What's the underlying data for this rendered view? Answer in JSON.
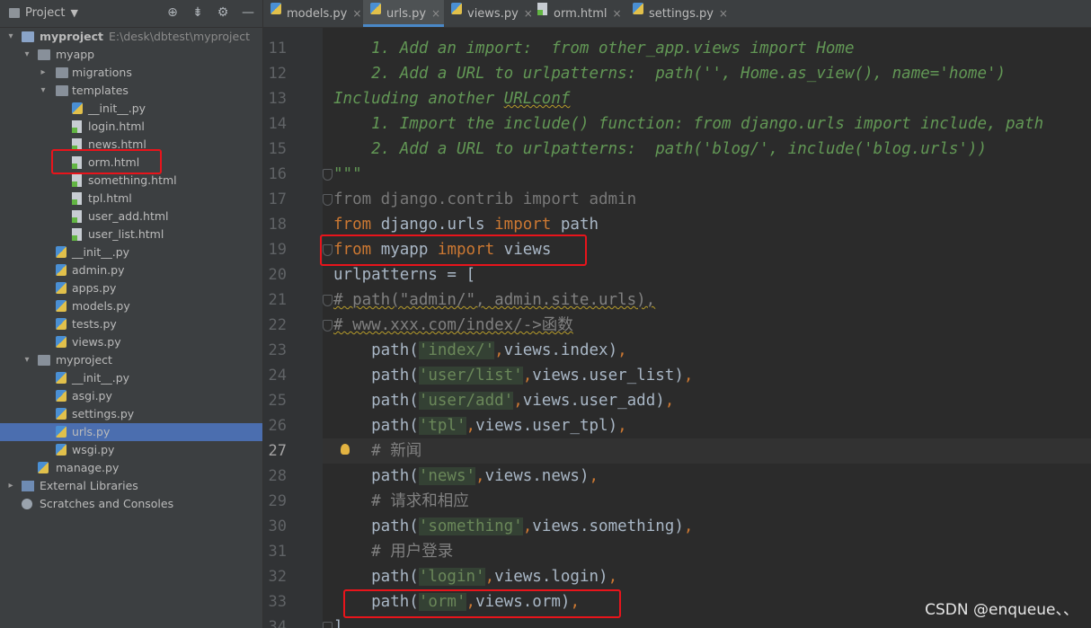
{
  "project_panel": {
    "title": "Project",
    "toolbar_icons": [
      "crosshair-icon",
      "collapse-all-icon",
      "gear-icon",
      "minimize-icon"
    ],
    "tree": [
      {
        "label": "myproject",
        "path": "E:\\desk\\dbtest\\myproject",
        "type": "root-folder",
        "level": 0,
        "arrow": "expanded"
      },
      {
        "label": "myapp",
        "type": "folder",
        "level": 1,
        "arrow": "expanded"
      },
      {
        "label": "migrations",
        "type": "folder",
        "level": 2,
        "arrow": "collapsed"
      },
      {
        "label": "templates",
        "type": "folder",
        "level": 2,
        "arrow": "expanded"
      },
      {
        "label": "__init__.py",
        "type": "py",
        "level": 3
      },
      {
        "label": "login.html",
        "type": "html",
        "level": 3
      },
      {
        "label": "news.html",
        "type": "html",
        "level": 3
      },
      {
        "label": "orm.html",
        "type": "html",
        "level": 3,
        "highlighted": true
      },
      {
        "label": "something.html",
        "type": "html",
        "level": 3
      },
      {
        "label": "tpl.html",
        "type": "html",
        "level": 3
      },
      {
        "label": "user_add.html",
        "type": "html",
        "level": 3
      },
      {
        "label": "user_list.html",
        "type": "html",
        "level": 3
      },
      {
        "label": "__init__.py",
        "type": "py",
        "level": 2
      },
      {
        "label": "admin.py",
        "type": "py",
        "level": 2
      },
      {
        "label": "apps.py",
        "type": "py",
        "level": 2
      },
      {
        "label": "models.py",
        "type": "py",
        "level": 2
      },
      {
        "label": "tests.py",
        "type": "py",
        "level": 2
      },
      {
        "label": "views.py",
        "type": "py",
        "level": 2
      },
      {
        "label": "myproject",
        "type": "folder",
        "level": 1,
        "arrow": "expanded"
      },
      {
        "label": "__init__.py",
        "type": "py",
        "level": 2
      },
      {
        "label": "asgi.py",
        "type": "py",
        "level": 2
      },
      {
        "label": "settings.py",
        "type": "py",
        "level": 2
      },
      {
        "label": "urls.py",
        "type": "py",
        "level": 2,
        "selected": true
      },
      {
        "label": "wsgi.py",
        "type": "py",
        "level": 2
      },
      {
        "label": "manage.py",
        "type": "py",
        "level": 1
      },
      {
        "label": "External Libraries",
        "type": "library",
        "level": 0,
        "arrow": "collapsed"
      },
      {
        "label": "Scratches and Consoles",
        "type": "scratch",
        "level": 0
      }
    ]
  },
  "tabs": [
    {
      "label": "models.py",
      "type": "py",
      "active": false
    },
    {
      "label": "urls.py",
      "type": "py",
      "active": true
    },
    {
      "label": "views.py",
      "type": "py",
      "active": false
    },
    {
      "label": "orm.html",
      "type": "html",
      "active": false
    },
    {
      "label": "settings.py",
      "type": "py",
      "active": false
    }
  ],
  "tab_close_glyph": "×",
  "editor": {
    "current_line": 27,
    "lines": [
      {
        "n": "11",
        "seg": [
          [
            "doc",
            "    1. Add an import:  from other_app.views import Home"
          ]
        ]
      },
      {
        "n": "12",
        "seg": [
          [
            "doc",
            "    2. Add a URL to urlpatterns:  path('', Home.as_view(), name='home')"
          ]
        ]
      },
      {
        "n": "13",
        "seg": [
          [
            "doc",
            "Including another "
          ],
          [
            "doc wavy",
            "URLconf"
          ]
        ]
      },
      {
        "n": "14",
        "seg": [
          [
            "doc",
            "    1. Import the include() function: from django.urls import include, path"
          ]
        ]
      },
      {
        "n": "15",
        "seg": [
          [
            "doc",
            "    2. Add a URL to urlpatterns:  path('blog/', include('blog.urls'))"
          ]
        ]
      },
      {
        "n": "16",
        "seg": [
          [
            "doc",
            "\"\"\""
          ]
        ],
        "fold": "end"
      },
      {
        "n": "17",
        "seg": [
          [
            "gray",
            "from django.contrib import admin"
          ]
        ],
        "fold": "start"
      },
      {
        "n": "18",
        "seg": [
          [
            "kw",
            "from"
          ],
          [
            "",
            " django.urls "
          ],
          [
            "kw",
            "import"
          ],
          [
            "",
            " path"
          ]
        ]
      },
      {
        "n": "19",
        "seg": [
          [
            "kw",
            "from"
          ],
          [
            "",
            " myapp "
          ],
          [
            "kw",
            "import"
          ],
          [
            "",
            " views"
          ]
        ],
        "fold": "end"
      },
      {
        "n": "20",
        "seg": [
          [
            "",
            "urlpatterns = ["
          ]
        ]
      },
      {
        "n": "21",
        "seg": [
          [
            "cmt wavy",
            "# path(\"admin/\", admin.site.urls),"
          ]
        ],
        "fold": "start"
      },
      {
        "n": "22",
        "seg": [
          [
            "cmt wavy",
            "# www.xxx.com/index/->函数"
          ]
        ],
        "fold": "end"
      },
      {
        "n": "23",
        "seg": [
          [
            "",
            "    path("
          ],
          [
            "strbg",
            "'index/'"
          ],
          [
            "kw",
            ","
          ],
          [
            "",
            "views.index"
          ],
          [
            "",
            ")"
          ],
          [
            "kw",
            ","
          ]
        ]
      },
      {
        "n": "24",
        "seg": [
          [
            "",
            "    path("
          ],
          [
            "strbg",
            "'user/list'"
          ],
          [
            "kw",
            ","
          ],
          [
            "",
            "views.user_list"
          ],
          [
            "",
            ")"
          ],
          [
            "kw",
            ","
          ]
        ]
      },
      {
        "n": "25",
        "seg": [
          [
            "",
            "    path("
          ],
          [
            "strbg",
            "'user/add'"
          ],
          [
            "kw",
            ","
          ],
          [
            "",
            "views.user_add"
          ],
          [
            "",
            ")"
          ],
          [
            "kw",
            ","
          ]
        ]
      },
      {
        "n": "26",
        "seg": [
          [
            "",
            "    path("
          ],
          [
            "strbg",
            "'tpl'"
          ],
          [
            "kw",
            ","
          ],
          [
            "",
            "views.user_tpl"
          ],
          [
            "",
            ")"
          ],
          [
            "kw",
            ","
          ]
        ]
      },
      {
        "n": "27",
        "seg": [
          [
            "cmt",
            "    # 新闻"
          ]
        ],
        "bulb": true
      },
      {
        "n": "28",
        "seg": [
          [
            "",
            "    path("
          ],
          [
            "strbg",
            "'news'"
          ],
          [
            "kw",
            ","
          ],
          [
            "",
            "views.news"
          ],
          [
            "",
            ")"
          ],
          [
            "kw",
            ","
          ]
        ]
      },
      {
        "n": "29",
        "seg": [
          [
            "cmt",
            "    # 请求和相应"
          ]
        ]
      },
      {
        "n": "30",
        "seg": [
          [
            "",
            "    path("
          ],
          [
            "strbg",
            "'something'"
          ],
          [
            "kw",
            ","
          ],
          [
            "",
            "views.something"
          ],
          [
            "",
            ")"
          ],
          [
            "kw",
            ","
          ]
        ]
      },
      {
        "n": "31",
        "seg": [
          [
            "cmt",
            "    # 用户登录"
          ]
        ]
      },
      {
        "n": "32",
        "seg": [
          [
            "",
            "    path("
          ],
          [
            "strbg",
            "'login'"
          ],
          [
            "kw",
            ","
          ],
          [
            "",
            "views.login"
          ],
          [
            "",
            ")"
          ],
          [
            "kw",
            ","
          ]
        ]
      },
      {
        "n": "33",
        "seg": [
          [
            "",
            "    path("
          ],
          [
            "strbg",
            "'orm'"
          ],
          [
            "kw",
            ","
          ],
          [
            "",
            "views.orm"
          ],
          [
            "",
            ")"
          ],
          [
            "kw",
            ","
          ]
        ]
      },
      {
        "n": "34",
        "seg": [
          [
            "",
            "]"
          ]
        ],
        "fold": "end"
      }
    ]
  },
  "watermark": "CSDN @enqueue、、",
  "colors": {
    "selection": "#4b6eaf",
    "highlight_box": "#e8141b",
    "keyword": "#cc7832",
    "string": "#6a8759",
    "docstring": "#629755",
    "comment": "#808080"
  }
}
